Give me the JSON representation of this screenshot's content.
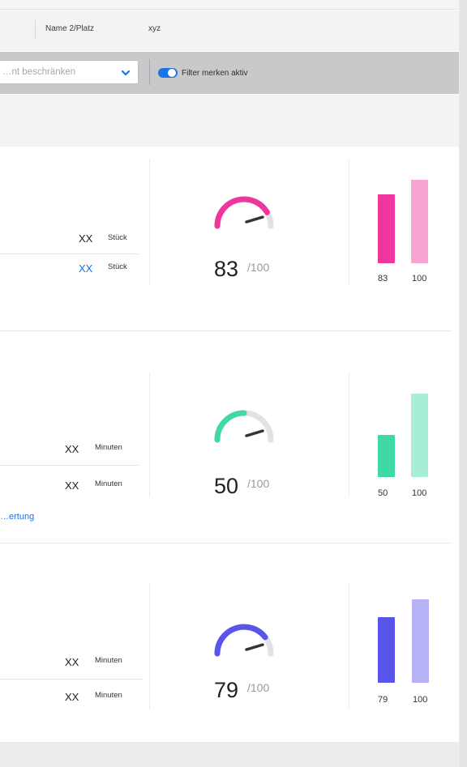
{
  "info": {
    "label": "Name 2/Platz",
    "value": "xyz"
  },
  "filter": {
    "select_placeholder": "…nt beschränken",
    "toggle_label": "Filter merken aktiv",
    "toggle_on": true,
    "accent": "#1a73e8"
  },
  "cards": [
    {
      "rows": [
        {
          "value": "XX",
          "unit": "Stück",
          "highlight": false
        },
        {
          "value": "XX",
          "unit": "Stück",
          "highlight": true
        }
      ],
      "link": "",
      "score": "83",
      "out_of": "/100",
      "ratio": 0.83,
      "color": "#f0359e",
      "bars": [
        {
          "label": "83",
          "value": 83
        },
        {
          "label": "100",
          "value": 100
        }
      ]
    },
    {
      "rows": [
        {
          "value": "XX",
          "unit": "Minuten",
          "highlight": false
        },
        {
          "value": "XX",
          "unit": "Minuten",
          "highlight": false
        }
      ],
      "link": "…ertung",
      "score": "50",
      "out_of": "/100",
      "ratio": 0.5,
      "color": "#3fd9a3",
      "bars": [
        {
          "label": "50",
          "value": 50
        },
        {
          "label": "100",
          "value": 100
        }
      ]
    },
    {
      "rows": [
        {
          "value": "XX",
          "unit": "Minuten",
          "highlight": false
        },
        {
          "value": "XX",
          "unit": "Minuten",
          "highlight": false
        }
      ],
      "link": "",
      "score": "79",
      "out_of": "/100",
      "ratio": 0.79,
      "color": "#5a55ea",
      "bars": [
        {
          "label": "79",
          "value": 79
        },
        {
          "label": "100",
          "value": 100
        }
      ]
    }
  ]
}
